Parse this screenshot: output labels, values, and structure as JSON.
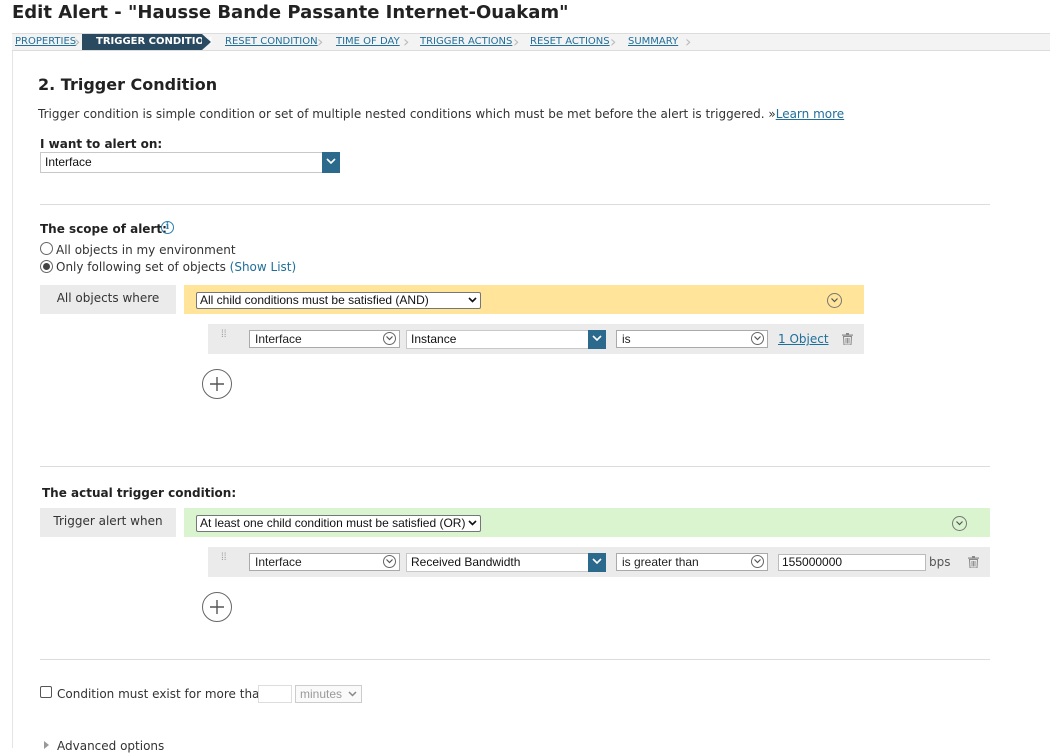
{
  "page_title": "Edit Alert - \"Hausse Bande Passante Internet-Ouakam\"",
  "wizard": {
    "steps": [
      {
        "label": "PROPERTIES",
        "active": false
      },
      {
        "label": "TRIGGER CONDITION",
        "active": true
      },
      {
        "label": "RESET CONDITION",
        "active": false
      },
      {
        "label": "TIME OF DAY",
        "active": false
      },
      {
        "label": "TRIGGER ACTIONS",
        "active": false
      },
      {
        "label": "RESET ACTIONS",
        "active": false
      },
      {
        "label": "SUMMARY",
        "active": false
      }
    ]
  },
  "section": {
    "heading": "2. Trigger Condition",
    "description": "Trigger condition is simple condition or set of multiple nested conditions which must be met before the alert is triggered. »",
    "learn_more": "Learn more"
  },
  "alert_on": {
    "label": "I want to alert on:",
    "value": "Interface"
  },
  "scope": {
    "label": "The scope of alert:",
    "options": [
      {
        "label": "All objects in my environment",
        "checked": false
      },
      {
        "label": "Only following set of objects",
        "checked": true
      }
    ],
    "show_list": "(Show List)",
    "where_label": "All objects where",
    "group_operator": "All child conditions must be satisfied (AND)",
    "condition": {
      "object": "Interface",
      "property": "Instance",
      "operator": "is",
      "value_link": "1 Object"
    }
  },
  "trigger": {
    "label": "The actual trigger condition:",
    "when_label": "Trigger alert when",
    "group_operator": "At least one child condition must be satisfied (OR)",
    "condition": {
      "object": "Interface",
      "property": "Received Bandwidth",
      "operator": "is greater than",
      "value": "155000000",
      "unit": "bps"
    }
  },
  "duration": {
    "label": "Condition must exist for more than",
    "amount": "",
    "unit": "minutes",
    "checked": false
  },
  "advanced": {
    "label": "Advanced options"
  },
  "colors": {
    "and_group": "#ffe49a",
    "or_group": "#d9f4cf",
    "active_step": "#2a4a62",
    "link": "#1f6f9a"
  }
}
